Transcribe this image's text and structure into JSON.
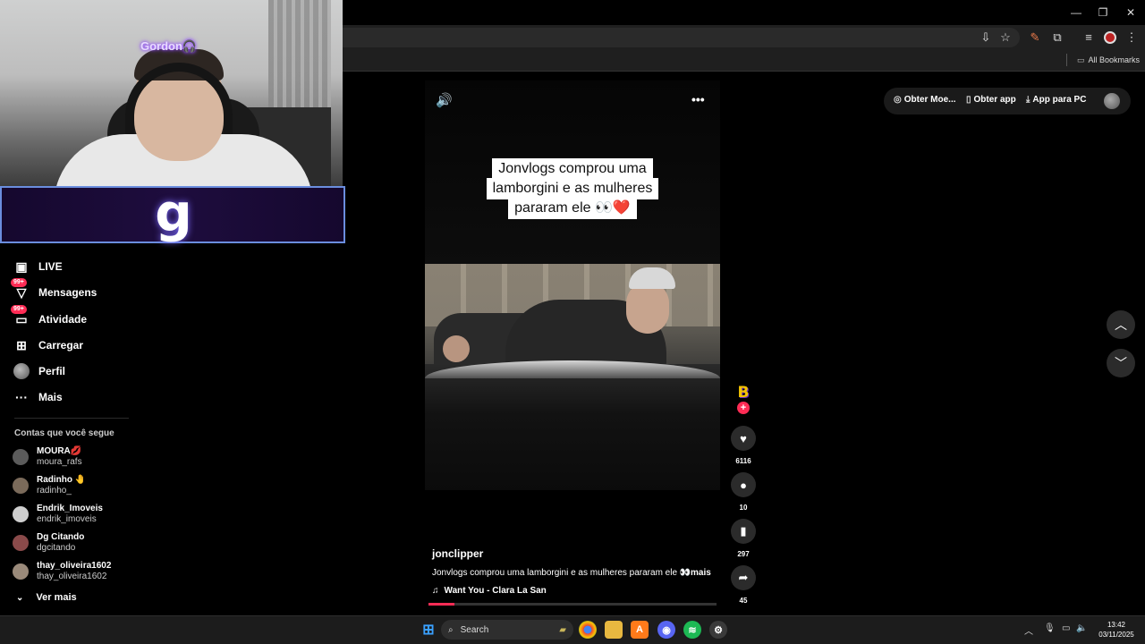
{
  "browser": {
    "window_controls": {
      "minimize": "—",
      "maximize": "❐",
      "close": "✕"
    },
    "bookmarks_label": "All Bookmarks"
  },
  "webcam": {
    "streamer_tag": "Gordon🎧",
    "logo_glyph": "g"
  },
  "sidebar": {
    "nav": [
      {
        "label": "LIVE",
        "icon": "live-icon"
      },
      {
        "label": "Mensagens",
        "icon": "message-icon",
        "badge": "99+"
      },
      {
        "label": "Atividade",
        "icon": "activity-icon",
        "badge": "99+"
      },
      {
        "label": "Carregar",
        "icon": "upload-icon"
      },
      {
        "label": "Perfil",
        "icon": "profile-avatar"
      },
      {
        "label": "Mais",
        "icon": "more-icon"
      }
    ],
    "following_title": "Contas que você segue",
    "following": [
      {
        "name": "MOURA💋",
        "handle": "moura_rafs"
      },
      {
        "name": "Radinho 🤚",
        "handle": "radinho_"
      },
      {
        "name": "Endrik_Imoveis",
        "handle": "endrik_imoveis"
      },
      {
        "name": "Dg Citando",
        "handle": "dgcitando"
      },
      {
        "name": "thay_oliveira1602",
        "handle": "thay_oliveira1602"
      }
    ],
    "see_more": "Ver mais"
  },
  "video": {
    "caption_lines": [
      "Jonvlogs comprou uma",
      "lamborgini e as mulheres",
      "pararam ele 👀❤️"
    ],
    "author": "jonclipper",
    "description": "Jonvlogs comprou uma lamborgini e as mulheres pararam ele 👀",
    "more_label": "mais",
    "music": "Want You - Clara La San",
    "progress": 0.09
  },
  "actions": {
    "creator_initial": "B",
    "likes": "6116",
    "comments": "10",
    "saves": "297",
    "shares": "45"
  },
  "top_buttons": {
    "coins": "Obter Moe...",
    "app": "Obter app",
    "pc_app": "App para PC"
  },
  "taskbar": {
    "search_placeholder": "Search",
    "time": "13:42",
    "date": "03/11/2025"
  },
  "colors": {
    "accent": "#fe2c55",
    "background": "#000000",
    "sidebar_text": "#ffffff"
  }
}
